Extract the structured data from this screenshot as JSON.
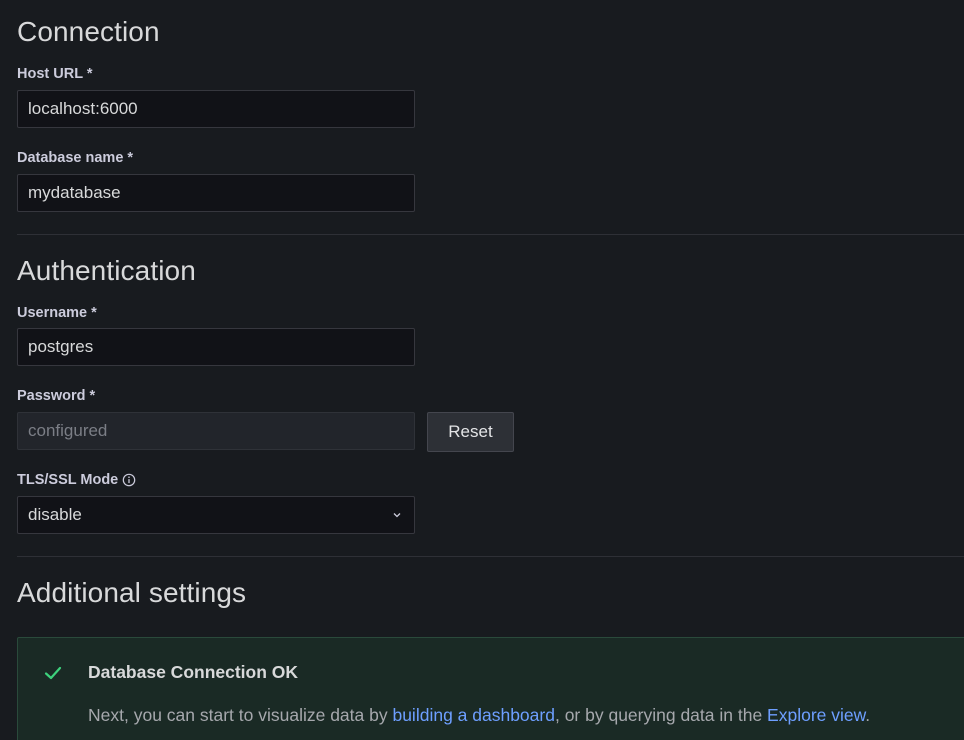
{
  "sections": {
    "connection_title": "Connection",
    "authentication_title": "Authentication",
    "additional_title": "Additional settings"
  },
  "connection": {
    "host_label": "Host URL *",
    "host_value": "localhost:6000",
    "db_label": "Database name *",
    "db_value": "mydatabase"
  },
  "auth": {
    "username_label": "Username *",
    "username_value": "postgres",
    "password_label": "Password *",
    "password_value": "configured",
    "reset_label": "Reset",
    "tls_label": "TLS/SSL Mode",
    "tls_value": "disable"
  },
  "alert": {
    "icon": "check-icon",
    "title": "Database Connection OK",
    "body_prefix": "Next, you can start to visualize data by ",
    "link1": "building a dashboard",
    "body_middle": ", or by querying data in the ",
    "link2": "Explore view",
    "body_suffix": "."
  },
  "colors": {
    "background": "#181b1f",
    "link": "#6e9fff",
    "success": "#3dd17c",
    "alert_bg": "#1a2a25"
  }
}
